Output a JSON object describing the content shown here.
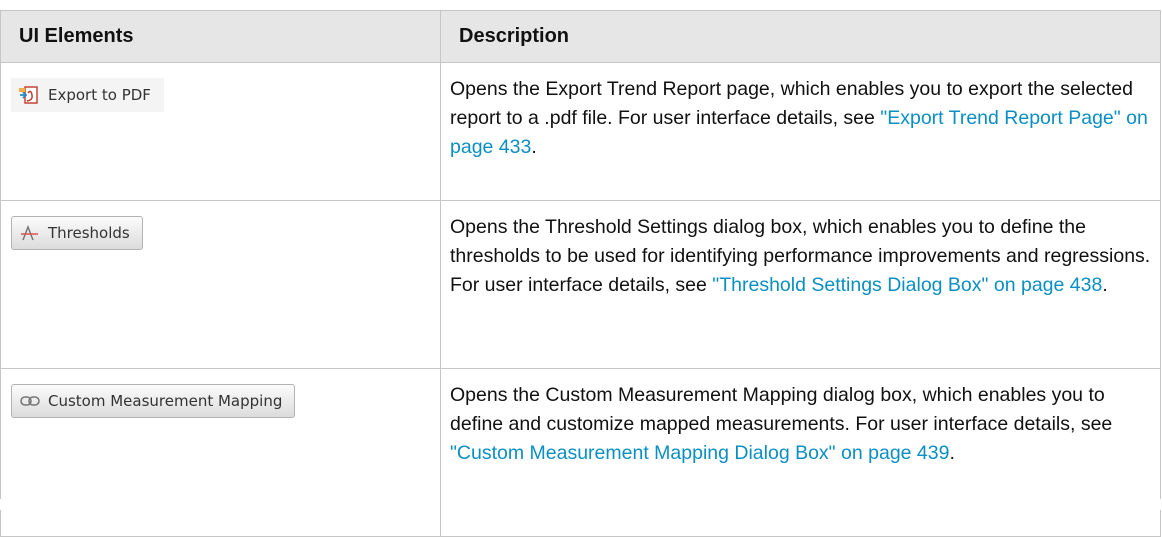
{
  "table": {
    "headers": [
      "UI Elements",
      "Description"
    ],
    "rows": [
      {
        "button": {
          "label": "Export to PDF",
          "icon": "pdf-export-icon"
        },
        "desc_pre": "Opens the Export Trend Report page, which enables you to export the selected report to a .pdf file. For user interface details, see ",
        "link": "\"Export Trend Report Page\" on page 433",
        "desc_post": "."
      },
      {
        "button": {
          "label": "Thresholds",
          "icon": "thresholds-icon"
        },
        "desc_pre": "Opens the Threshold Settings dialog box, which enables you to define the thresholds to be used for identifying performance improvements and regressions. For user interface details, see ",
        "link": "\"Threshold Settings Dialog Box\" on page 438",
        "desc_post": "."
      },
      {
        "button": {
          "label": "Custom Measurement Mapping",
          "icon": "chain-link-icon"
        },
        "desc_pre": "Opens the Custom Measurement Mapping dialog box, which enables you to define and customize mapped measurements. For user interface details, see ",
        "link": "\"Custom Measurement Mapping Dialog Box\" on page 439",
        "desc_post": "."
      }
    ]
  },
  "colors": {
    "header_bg": "#e6e6e6",
    "border": "#c6c6c6",
    "link": "#0b8fc2"
  }
}
